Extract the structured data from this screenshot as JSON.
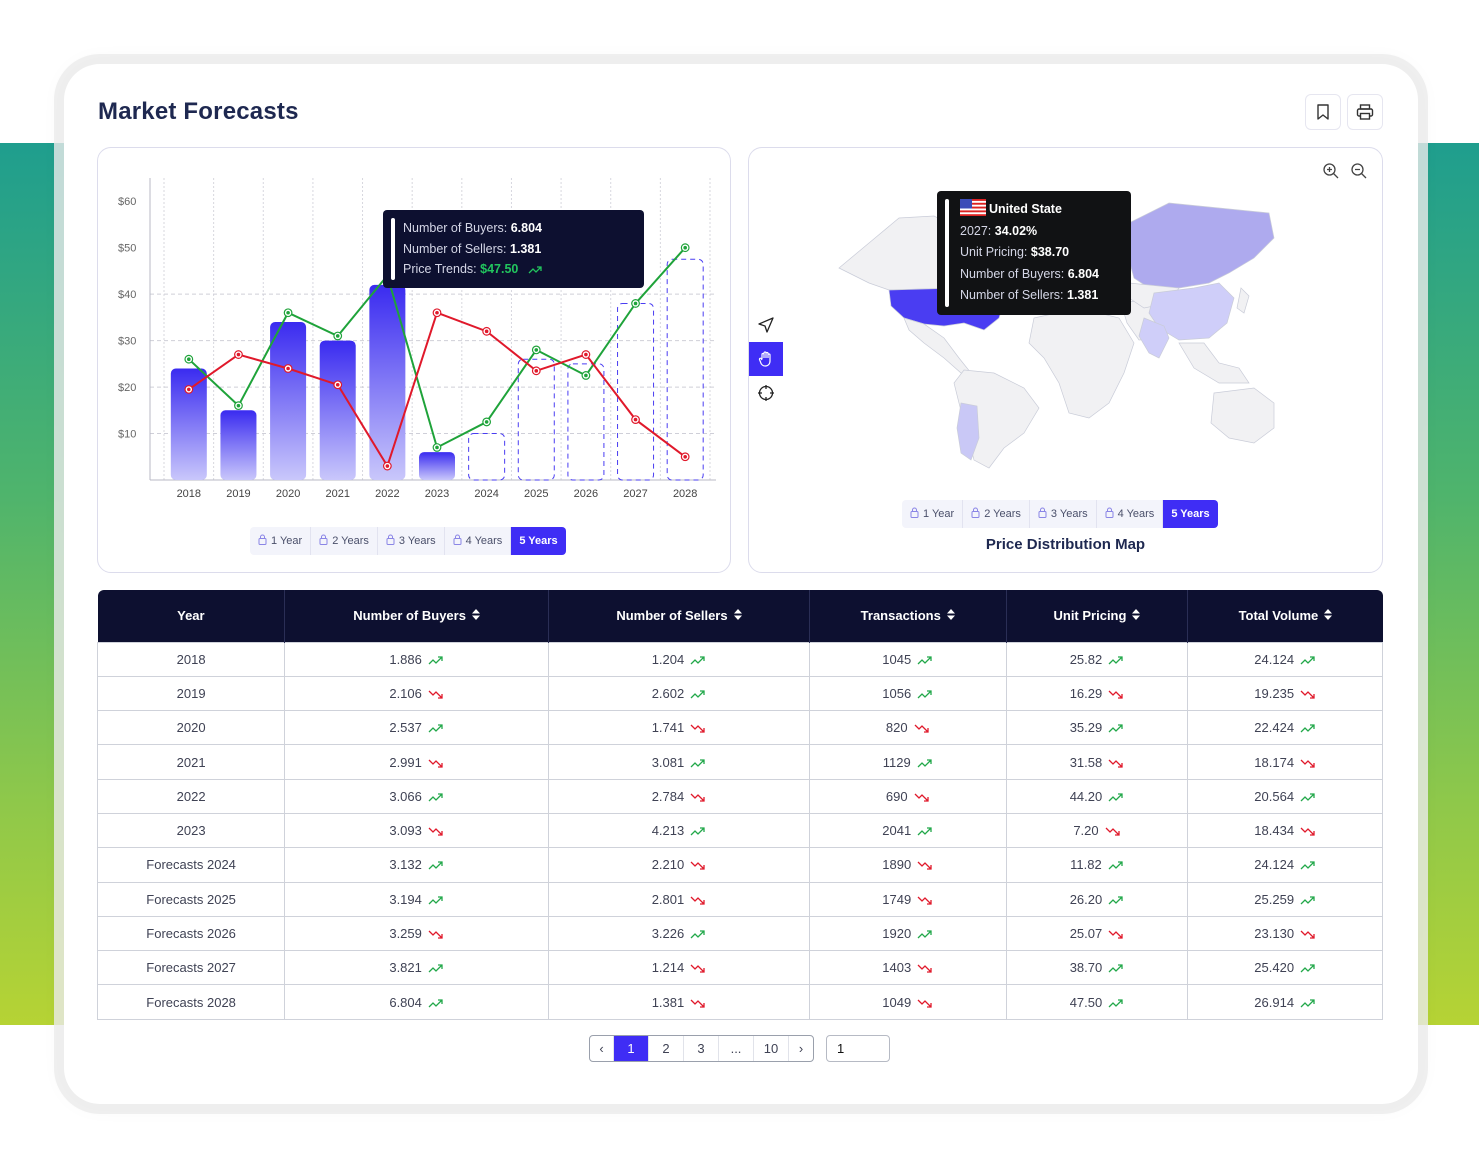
{
  "header": {
    "title": "Market Forecasts",
    "bookmark_icon": "bookmark-icon",
    "print_icon": "print-icon"
  },
  "colors": {
    "accent": "#3f2df5",
    "navy": "#0d1030",
    "up": "#22a84a",
    "down": "#e0192b",
    "buyers_line": "#1fa33a",
    "sellers_line": "#e0192b"
  },
  "left_panel": {
    "periods": [
      {
        "label": "1 Year",
        "locked": true,
        "active": false
      },
      {
        "label": "2 Years",
        "locked": true,
        "active": false
      },
      {
        "label": "3 Years",
        "locked": true,
        "active": false
      },
      {
        "label": "4 Years",
        "locked": true,
        "active": false
      },
      {
        "label": "5 Years",
        "locked": false,
        "active": true
      }
    ],
    "tooltip": {
      "buyers_label": "Number of Buyers:",
      "buyers_value": "6.804",
      "sellers_label": "Number of Sellers:",
      "sellers_value": "1.381",
      "price_label": "Price Trends:",
      "price_value": "$47.50"
    }
  },
  "chart_data": {
    "type": "bar",
    "title": "",
    "xlabel": "",
    "ylabel": "",
    "categories": [
      "2018",
      "2019",
      "2020",
      "2021",
      "2022",
      "2023",
      "2024",
      "2025",
      "2026",
      "2027",
      "2028"
    ],
    "ylim": [
      0,
      65
    ],
    "yticks": [
      10,
      20,
      30,
      40,
      50,
      60
    ],
    "ytick_labels": [
      "$10",
      "$20",
      "$30",
      "$40",
      "$50",
      "$60"
    ],
    "grid": true,
    "series": [
      {
        "name": "Unit Pricing",
        "kind": "bar",
        "values": [
          24,
          15,
          34,
          30,
          42,
          6,
          10,
          26,
          25,
          38,
          47.5
        ],
        "forecast": [
          false,
          false,
          false,
          false,
          false,
          false,
          true,
          true,
          true,
          true,
          true
        ]
      },
      {
        "name": "Number of Buyers",
        "kind": "line",
        "color": "green",
        "values": [
          26,
          16,
          36,
          31,
          44,
          7,
          12.5,
          28,
          22.5,
          38,
          50
        ]
      },
      {
        "name": "Number of Sellers",
        "kind": "line",
        "color": "red",
        "values": [
          19.5,
          27,
          24,
          20.5,
          3,
          36,
          32,
          23.5,
          27,
          13,
          5
        ]
      }
    ]
  },
  "right_panel": {
    "title": "Price Distribution Map",
    "zoom_in_icon": "zoom-in-icon",
    "zoom_out_icon": "zoom-out-icon",
    "tools": [
      "navigate-icon",
      "hand-icon",
      "crosshair-icon"
    ],
    "active_tool": "hand-icon",
    "periods": [
      {
        "label": "1 Year",
        "locked": true,
        "active": false
      },
      {
        "label": "2 Years",
        "locked": true,
        "active": false
      },
      {
        "label": "3 Years",
        "locked": true,
        "active": false
      },
      {
        "label": "4 Years",
        "locked": true,
        "active": false
      },
      {
        "label": "5 Years",
        "locked": false,
        "active": true
      }
    ],
    "tooltip": {
      "country": "United State",
      "year_label": "2027:",
      "year_value": "34.02%",
      "pricing_label": "Unit Pricing:",
      "pricing_value": "$38.70",
      "buyers_label": "Number of Buyers:",
      "buyers_value": "6.804",
      "sellers_label": "Number of Sellers:",
      "sellers_value": "1.381"
    },
    "regions": [
      {
        "name": "United States",
        "shade": "strong"
      },
      {
        "name": "Russia",
        "shade": "medium"
      },
      {
        "name": "China",
        "shade": "light"
      },
      {
        "name": "India",
        "shade": "light"
      },
      {
        "name": "Argentina",
        "shade": "light"
      }
    ]
  },
  "table": {
    "columns": [
      "Year",
      "Number of Buyers",
      "Number of Sellers",
      "Transactions",
      "Unit Pricing",
      "Total Volume"
    ],
    "rows": [
      {
        "year": "2018",
        "cells": [
          [
            "1.886",
            "up"
          ],
          [
            "1.204",
            "up"
          ],
          [
            "1045",
            "up"
          ],
          [
            "25.82",
            "up"
          ],
          [
            "24.124",
            "up"
          ]
        ]
      },
      {
        "year": "2019",
        "cells": [
          [
            "2.106",
            "down"
          ],
          [
            "2.602",
            "up"
          ],
          [
            "1056",
            "up"
          ],
          [
            "16.29",
            "down"
          ],
          [
            "19.235",
            "down"
          ]
        ]
      },
      {
        "year": "2020",
        "cells": [
          [
            "2.537",
            "up"
          ],
          [
            "1.741",
            "down"
          ],
          [
            "820",
            "down"
          ],
          [
            "35.29",
            "up"
          ],
          [
            "22.424",
            "up"
          ]
        ]
      },
      {
        "year": "2021",
        "cells": [
          [
            "2.991",
            "down"
          ],
          [
            "3.081",
            "up"
          ],
          [
            "1129",
            "up"
          ],
          [
            "31.58",
            "down"
          ],
          [
            "18.174",
            "down"
          ]
        ]
      },
      {
        "year": "2022",
        "cells": [
          [
            "3.066",
            "up"
          ],
          [
            "2.784",
            "down"
          ],
          [
            "690",
            "down"
          ],
          [
            "44.20",
            "up"
          ],
          [
            "20.564",
            "up"
          ]
        ]
      },
      {
        "year": "2023",
        "cells": [
          [
            "3.093",
            "down"
          ],
          [
            "4.213",
            "up"
          ],
          [
            "2041",
            "up"
          ],
          [
            "7.20",
            "down"
          ],
          [
            "18.434",
            "down"
          ]
        ]
      },
      {
        "year": "Forecasts 2024",
        "cells": [
          [
            "3.132",
            "up"
          ],
          [
            "2.210",
            "down"
          ],
          [
            "1890",
            "down"
          ],
          [
            "11.82",
            "up"
          ],
          [
            "24.124",
            "up"
          ]
        ]
      },
      {
        "year": "Forecasts 2025",
        "cells": [
          [
            "3.194",
            "up"
          ],
          [
            "2.801",
            "down"
          ],
          [
            "1749",
            "down"
          ],
          [
            "26.20",
            "up"
          ],
          [
            "25.259",
            "up"
          ]
        ]
      },
      {
        "year": "Forecasts 2026",
        "cells": [
          [
            "3.259",
            "down"
          ],
          [
            "3.226",
            "up"
          ],
          [
            "1920",
            "up"
          ],
          [
            "25.07",
            "down"
          ],
          [
            "23.130",
            "down"
          ]
        ]
      },
      {
        "year": "Forecasts 2027",
        "cells": [
          [
            "3.821",
            "up"
          ],
          [
            "1.214",
            "down"
          ],
          [
            "1403",
            "down"
          ],
          [
            "38.70",
            "up"
          ],
          [
            "25.420",
            "up"
          ]
        ]
      },
      {
        "year": "Forecasts 2028",
        "cells": [
          [
            "6.804",
            "up"
          ],
          [
            "1.381",
            "down"
          ],
          [
            "1049",
            "down"
          ],
          [
            "47.50",
            "up"
          ],
          [
            "26.914",
            "up"
          ]
        ]
      }
    ]
  },
  "pagination": {
    "prev": "‹",
    "next": "›",
    "pages": [
      "1",
      "2",
      "3",
      "...",
      "10"
    ],
    "current": "1",
    "goto_value": "1"
  }
}
